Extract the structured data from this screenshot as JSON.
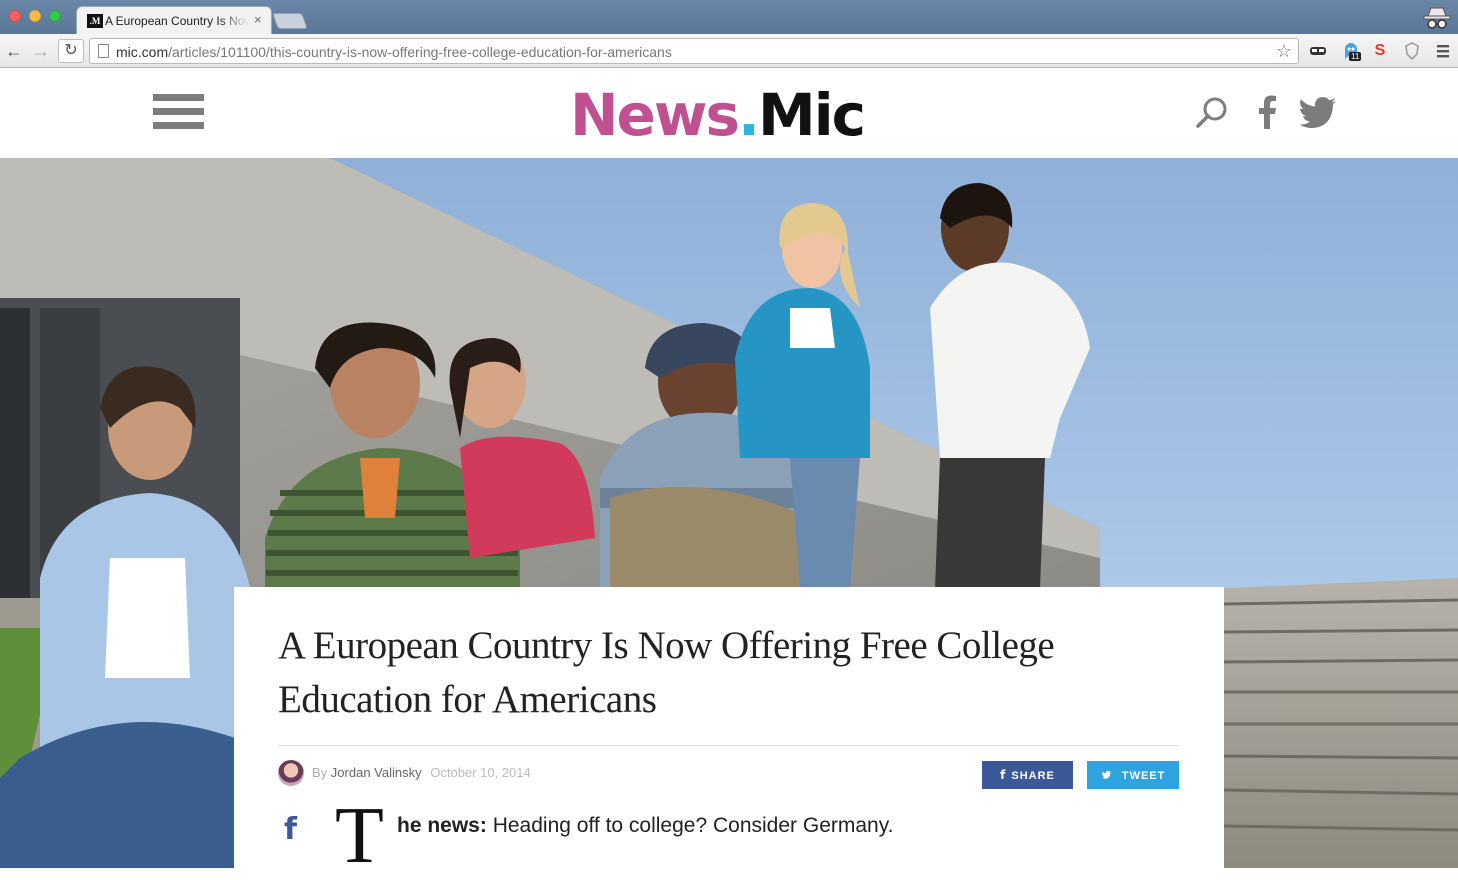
{
  "browser": {
    "tab_title": "A European Country Is Now Offering Free College Education for Americans",
    "tab_favicon": ".M",
    "tab_close": "×",
    "url_host": "mic.com",
    "url_path": "/articles/101100/this-country-is-now-offering-free-college-education-for-americans",
    "extension_badge": "11",
    "extension_s": "S"
  },
  "site": {
    "logo_news": "News",
    "logo_dot": ".",
    "logo_mic": "Mic",
    "brand_colors": {
      "news": "#c0508f",
      "dot": "#2eb5e0",
      "mic": "#111111"
    }
  },
  "article": {
    "headline": "A European Country Is Now Offering Free College Education for Americans",
    "by": "By",
    "author": "Jordan Valinsky",
    "date": "October 10, 2014",
    "share_label": "SHARE",
    "tweet_label": "TWEET",
    "share_color": "#3b5998",
    "tweet_color": "#2fa3e0",
    "dropcap": "T",
    "lede_bold": "he news:",
    "lede_text": "Heading off to college? Consider Germany."
  },
  "icons": [
    "search-icon",
    "facebook-icon",
    "twitter-icon",
    "hamburger-menu-icon",
    "star-icon",
    "reload-icon",
    "back-arrow-icon",
    "forward-arrow-icon",
    "incognito-icon"
  ]
}
